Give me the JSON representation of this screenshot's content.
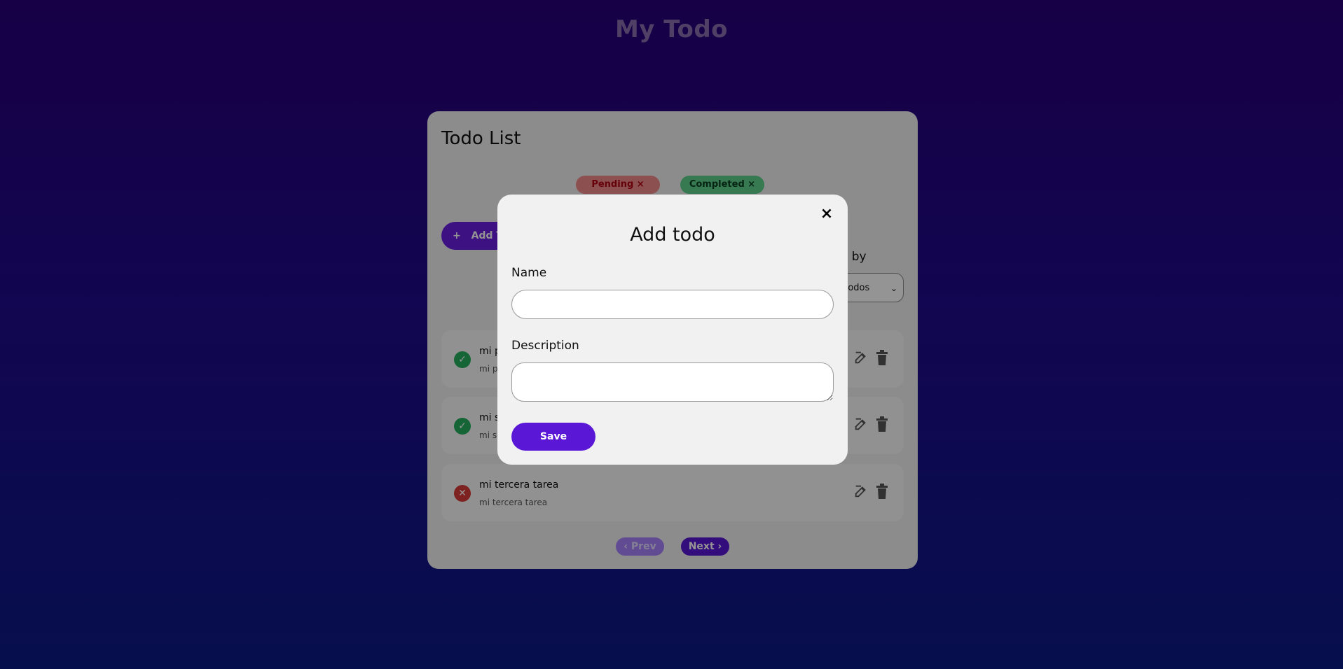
{
  "app": {
    "title": "My Todo"
  },
  "card": {
    "title": "Todo List",
    "filters": [
      {
        "label": "Pending ×"
      },
      {
        "label": "Completed ×"
      }
    ],
    "add_button": {
      "label": "Add Todo",
      "icon": "plus-icon"
    },
    "view_by": {
      "label": "View by",
      "selected": "All todos"
    },
    "todos": [
      {
        "name": "mi primera tarea",
        "description": "mi primera tarea",
        "status": "completed"
      },
      {
        "name": "mi segunda tarea",
        "description": "mi segunda tarea",
        "status": "completed"
      },
      {
        "name": "mi tercera tarea",
        "description": "mi tercera tarea",
        "status": "pending"
      }
    ],
    "pagination": {
      "prev": "Prev",
      "next": "Next"
    }
  },
  "modal": {
    "title": "Add todo",
    "name_label": "Name",
    "name_value": "",
    "description_label": "Description",
    "description_value": "",
    "save_label": "Save",
    "close_symbol": "×"
  },
  "colors": {
    "accent": "#5a18d6",
    "pending": "#f28b8b",
    "completed": "#5fd38c"
  }
}
